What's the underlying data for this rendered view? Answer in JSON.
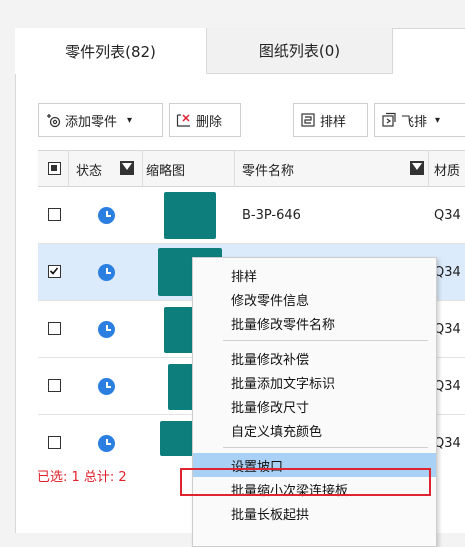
{
  "tabs": {
    "parts_list": "零件列表(82)",
    "drawings_list": "图纸列表(0)"
  },
  "toolbar": {
    "add_part": "添加零件",
    "delete": "删除",
    "nest": "排样",
    "fly_nest": "飞排"
  },
  "table": {
    "headers": {
      "status": "状态",
      "thumbnail": "缩略图",
      "part_name": "零件名称",
      "material": "材质"
    },
    "rows": [
      {
        "part_name": "B-3P-646",
        "material": "Q34",
        "checked": false
      },
      {
        "part_name": "",
        "material": "Q34",
        "checked": true
      },
      {
        "part_name": "",
        "material": "Q34",
        "checked": false
      },
      {
        "part_name": "",
        "material": "Q34",
        "checked": false
      },
      {
        "part_name": "",
        "material": "Q34",
        "checked": false
      }
    ]
  },
  "status_bar": {
    "text": "已选: 1  总计: 2"
  },
  "context_menu": {
    "group1": [
      "排样",
      "修改零件信息",
      "批量修改零件名称"
    ],
    "group2": [
      "批量修改补偿",
      "批量添加文字标识",
      "批量修改尺寸",
      "自定义填充颜色"
    ],
    "group3": [
      "设置坡口",
      "批量缩小次梁连接板",
      "批量长板起拱"
    ]
  },
  "colors": {
    "thumbnail": "#0d7e7c",
    "status_clock": "#2b7fe0",
    "selected_row": "#dcebfb",
    "menu_highlight": "#a9d1f5",
    "annotation_box": "#e0242f",
    "status_text": "#e0202a"
  }
}
